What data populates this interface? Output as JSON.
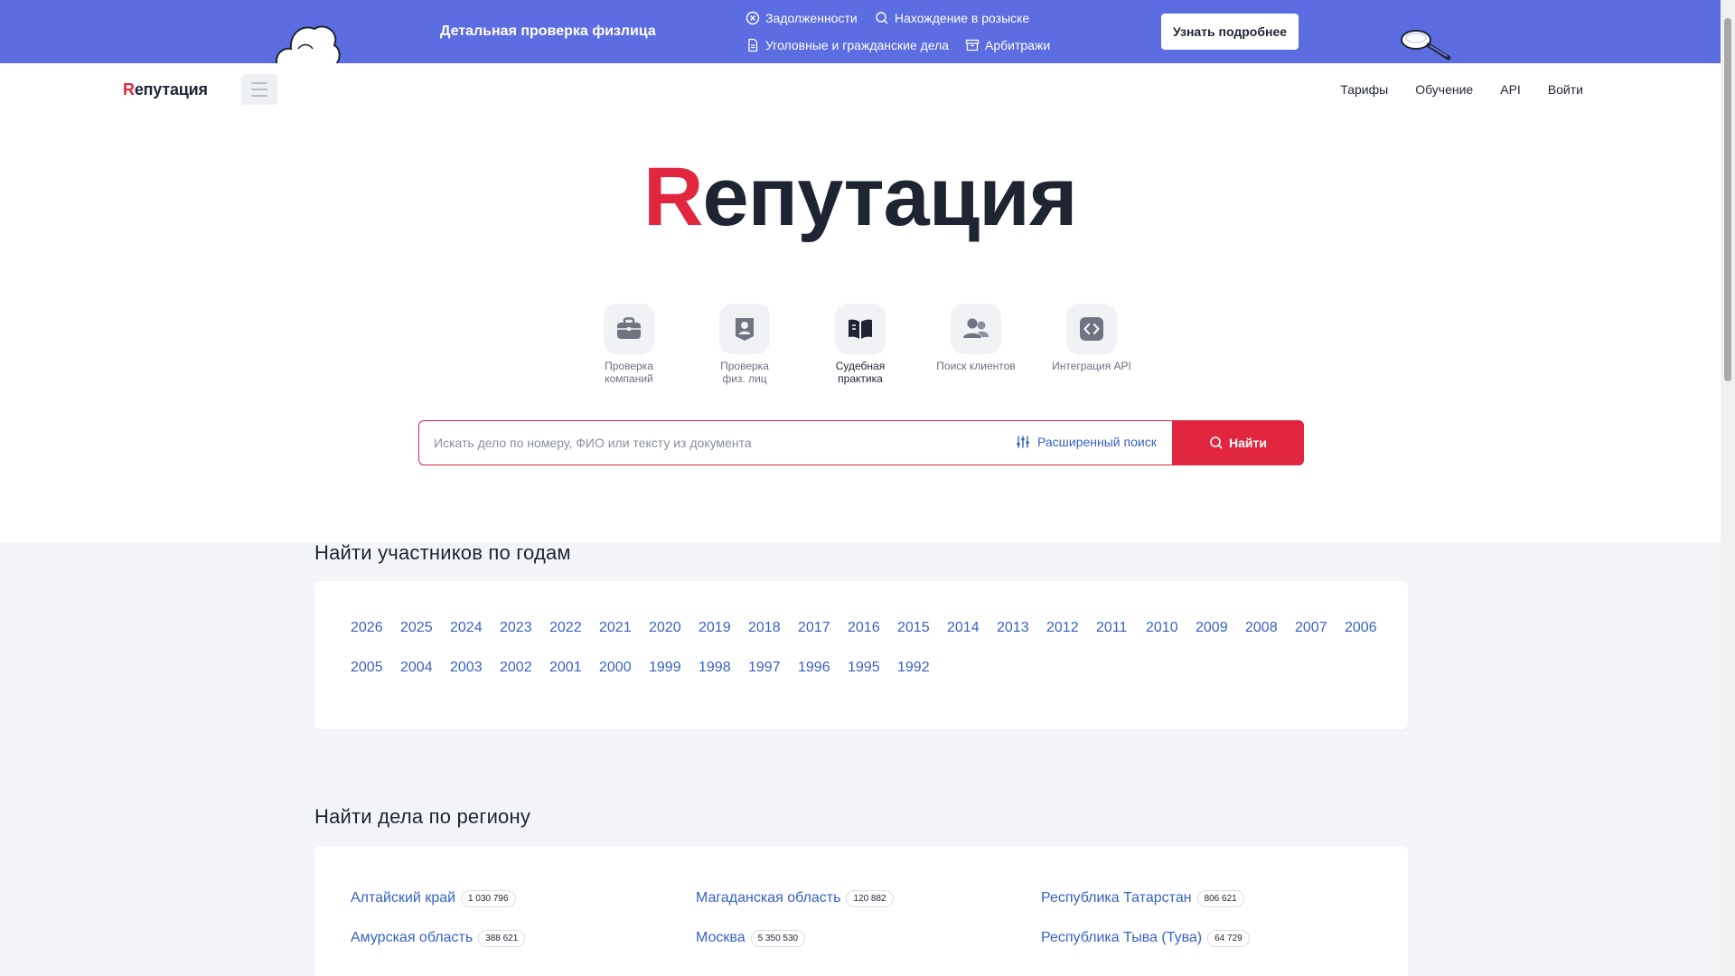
{
  "promo": {
    "title": "Детальная проверка физлица",
    "features": [
      {
        "label": "Задолженности",
        "icon": "circle-x-icon"
      },
      {
        "label": "Нахождение в розыске",
        "icon": "search-icon"
      },
      {
        "label": "Уголовные и гражданские дела",
        "icon": "document-icon"
      },
      {
        "label": "Арбитражи",
        "icon": "archive-box-icon"
      }
    ],
    "button": "Узнать подробнее",
    "bg_color": "#5b6de0"
  },
  "header": {
    "logo_r": "R",
    "logo_rest": "епутация",
    "nav": [
      "Тарифы",
      "Обучение",
      "API",
      "Войти"
    ]
  },
  "hero": {
    "logo_r": "R",
    "logo_rest": "епутация",
    "quick_links": [
      {
        "line1": "Проверка",
        "line2": "компаний",
        "icon": "briefcase-icon"
      },
      {
        "line1": "Проверка",
        "line2": "физ. лиц",
        "icon": "person-badge-icon"
      },
      {
        "line1": "Судебная",
        "line2": "практика",
        "icon": "open-book-icon"
      },
      {
        "line1": "Поиск клиентов",
        "line2": "",
        "icon": "users-icon"
      },
      {
        "line1": "Интеграция API",
        "line2": "",
        "icon": "code-icon"
      }
    ],
    "search": {
      "placeholder": "Искать дело по номеру, ФИО или тексту из документа",
      "value": "",
      "advanced": "Расширенный поиск",
      "button": "Найти"
    }
  },
  "years_section": {
    "title": "Найти участников по годам",
    "years": [
      "2026",
      "2025",
      "2024",
      "2023",
      "2022",
      "2021",
      "2020",
      "2019",
      "2018",
      "2017",
      "2016",
      "2015",
      "2014",
      "2013",
      "2012",
      "2011",
      "2010",
      "2009",
      "2008",
      "2007",
      "2006",
      "2005",
      "2004",
      "2003",
      "2002",
      "2001",
      "2000",
      "1999",
      "1998",
      "1997",
      "1996",
      "1995",
      "1992"
    ]
  },
  "regions_section": {
    "title": "Найти дела по региону",
    "regions": [
      {
        "name": "Алтайский край",
        "count": "1 030 796"
      },
      {
        "name": "Магаданская область",
        "count": "120 882"
      },
      {
        "name": "Республика Татарстан",
        "count": "806 621"
      },
      {
        "name": "Амурская область",
        "count": "388 621"
      },
      {
        "name": "Москва",
        "count": "5 350 530"
      },
      {
        "name": "Республика Тыва (Тува)",
        "count": "64 729"
      }
    ]
  },
  "colors": {
    "accent_red": "#e3263f",
    "link_blue": "#3662c4",
    "text_dark": "#1f2433"
  }
}
